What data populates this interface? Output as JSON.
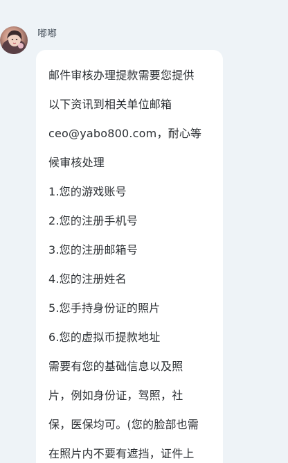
{
  "sender": {
    "name": "嘟嘟"
  },
  "message": {
    "lines": [
      "邮件审核办理提款需要您提供",
      "以下资讯到相关单位邮箱",
      "ceo@yabo800.com，耐心等",
      "候审核处理",
      "1.您的游戏账号",
      "2.您的注册手机号",
      "3.您的注册邮箱号",
      "4.您的注册姓名",
      "5.您手持身份证的照片",
      "6.您的虚拟币提款地址",
      "需要有您的基础信息以及照",
      "片，例如身份证，驾照，社",
      "保，医保均可。(您的脸部也需",
      "在照片内不要有遮挡，证件上"
    ]
  },
  "colors": {
    "background": "#eef3f7",
    "bubble": "#ffffff",
    "text": "#2b2f33",
    "name": "#5d6670"
  }
}
